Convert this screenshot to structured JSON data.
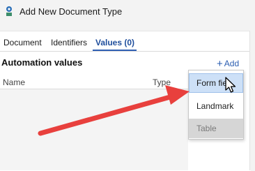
{
  "window": {
    "title": "Add New Document Type",
    "icon": "doc-type-app-icon"
  },
  "tabs": [
    {
      "label": "Document",
      "active": false
    },
    {
      "label": "Identifiers",
      "active": false
    },
    {
      "label": "Values (0)",
      "active": true
    }
  ],
  "section": {
    "title": "Automation values",
    "add_label": "Add",
    "add_icon": "plus-icon"
  },
  "table": {
    "columns": [
      "Name",
      "Type"
    ]
  },
  "dropdown": {
    "items": [
      {
        "label": "Form fie",
        "state": "hover"
      },
      {
        "label": "Landmark",
        "state": "normal"
      },
      {
        "label": "Table",
        "state": "disabled"
      }
    ]
  },
  "colors": {
    "accent": "#2a5db0",
    "hover": "#cde0f7",
    "annotation_arrow": "#e8403d"
  }
}
